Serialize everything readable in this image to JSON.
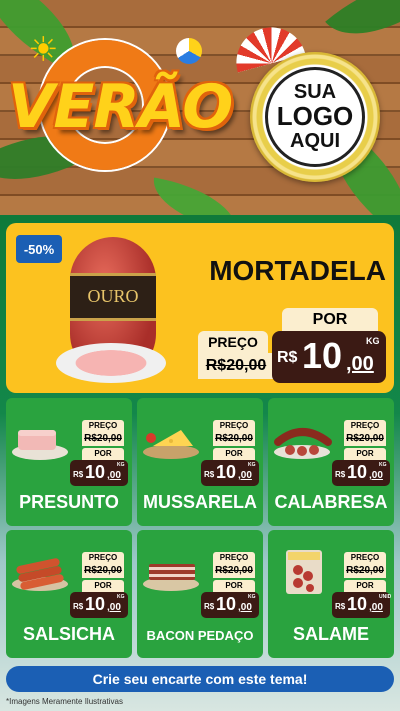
{
  "header": {
    "title": "VERÃO",
    "logo_line1": "SUA",
    "logo_line2": "LOGO",
    "logo_line3": "AQUI"
  },
  "hero": {
    "badge": "-50%",
    "brand": "OURO",
    "name": "MORTADELA",
    "preco_label": "PREÇO",
    "old_price": "R$20,00",
    "por_label": "POR",
    "currency": "R$",
    "price_int": "10",
    "price_dec": ",00",
    "unit": "KG"
  },
  "products": [
    {
      "name": "PRESUNTO",
      "preco_label": "PREÇO",
      "old_price": "R$20,00",
      "por_label": "POR",
      "currency": "R$",
      "price_int": "10",
      "price_dec": ",00",
      "unit": "KG"
    },
    {
      "name": "MUSSARELA",
      "preco_label": "PREÇO",
      "old_price": "R$20,00",
      "por_label": "POR",
      "currency": "R$",
      "price_int": "10",
      "price_dec": ",00",
      "unit": "KG"
    },
    {
      "name": "CALABRESA",
      "preco_label": "PREÇO",
      "old_price": "R$20,00",
      "por_label": "POR",
      "currency": "R$",
      "price_int": "10",
      "price_dec": ",00",
      "unit": "KG"
    },
    {
      "name": "SALSICHA",
      "preco_label": "PREÇO",
      "old_price": "R$20,00",
      "por_label": "POR",
      "currency": "R$",
      "price_int": "10",
      "price_dec": ",00",
      "unit": "KG"
    },
    {
      "name": "BACON PEDAÇO",
      "preco_label": "PREÇO",
      "old_price": "R$20,00",
      "por_label": "POR",
      "currency": "R$",
      "price_int": "10",
      "price_dec": ",00",
      "unit": "KG"
    },
    {
      "name": "SALAME",
      "preco_label": "PREÇO",
      "old_price": "R$20,00",
      "por_label": "POR",
      "currency": "R$",
      "price_int": "10",
      "price_dec": ",00",
      "unit": "UNID"
    }
  ],
  "footer": {
    "cta": "Crie seu encarte com este tema!",
    "disclaimer": "*Imagens Meramente Ilustrativas"
  },
  "colors": {
    "hero_bg": "#fcc21f",
    "card_bg": "#2aa33f",
    "badge_bg": "#1b5fb4",
    "price_bg": "#3b1a14"
  }
}
